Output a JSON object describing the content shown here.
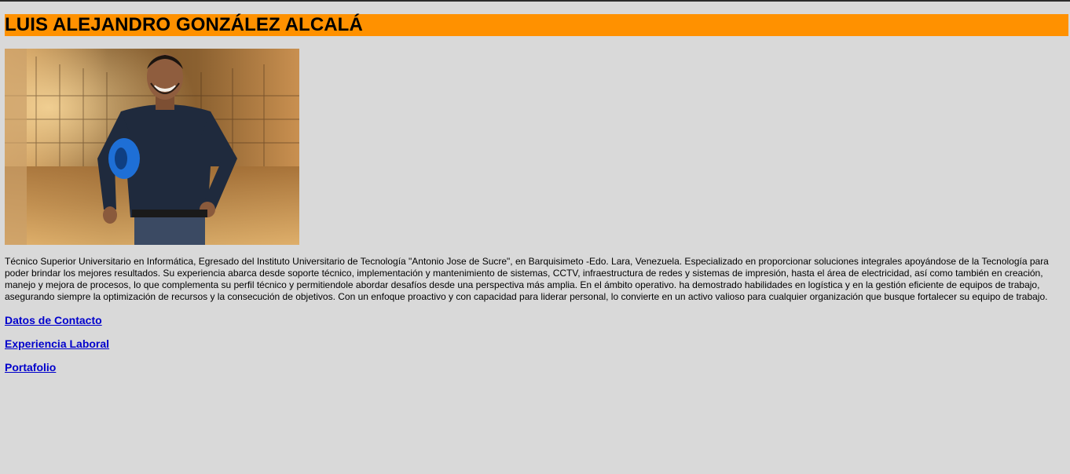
{
  "header": {
    "name": "LUIS ALEJANDRO GONZÁLEZ ALCALÁ",
    "accent_color": "#ff9100",
    "background_color": "#d9d9d9"
  },
  "photo": {
    "alt": "Luis Alejandro González Alcalá"
  },
  "bio": {
    "text": "Técnico Superior Universitario en Informática, Egresado del Instituto Universitario de Tecnología \"Antonio Jose de Sucre\", en Barquisimeto -Edo. Lara, Venezuela. Especializado en proporcionar soluciones integrales apoyándose de la Tecnología para poder brindar los mejores resultados. Su experiencia abarca desde soporte técnico, implementación y mantenimiento de sistemas, CCTV, infraestructura de redes y sistemas de impresión, hasta el área de electricidad, así como también en creación, manejo y mejora de procesos, lo que complementa su perfil técnico y permitiendole abordar desafíos desde una perspectiva más amplia. En el ámbito operativo. ha demostrado habilidades en logística y en la gestión eficiente de equipos de trabajo, asegurando siempre la optimización de recursos y la consecución de objetivos. Con un enfoque proactivo y con capacidad para liderar personal, lo convierte en un activo valioso para cualquier organización que busque fortalecer su equipo de trabajo."
  },
  "links": {
    "contact": "Datos de Contacto",
    "experience": "Experiencia Laboral",
    "portfolio": "Portafolio",
    "link_color": "#0000cc"
  }
}
